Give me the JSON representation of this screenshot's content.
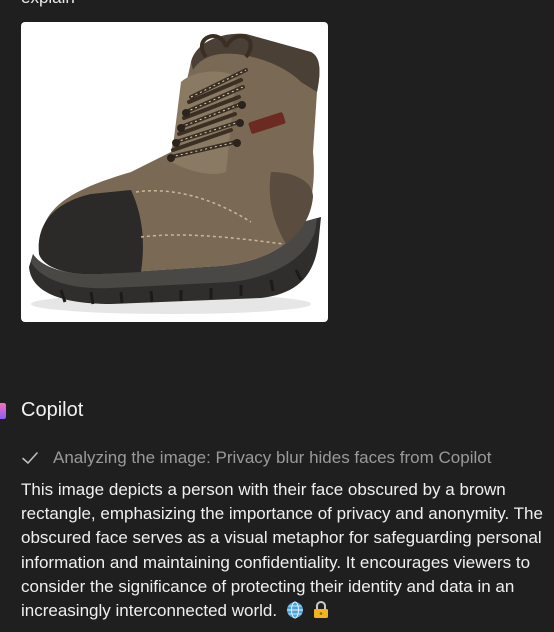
{
  "user_message": {
    "text": "explain"
  },
  "attachment": {
    "icon": "boot-image",
    "description_colors": {
      "boot_body": "#7a6a55",
      "toe_cap": "#2b2a28",
      "sole": "#3a3a38",
      "laces": "#3b2f24"
    }
  },
  "assistant": {
    "name": "Copilot",
    "status": "Analyzing the image: Privacy blur hides faces from Copilot",
    "response": "This image depicts a person with their face obscured by a brown rectangle, emphasizing the importance of privacy and anonymity. The obscured face serves as a visual metaphor for safeguarding personal information and maintaining confidentiality. It encourages viewers to consider the significance of protecting their identity and data in an increasingly interconnected world.",
    "emojis": [
      "globe-icon",
      "lock-icon"
    ]
  },
  "colors": {
    "background": "#1f1f1f",
    "status_text": "#9a9a9a",
    "primary_text": "#f0f0f0"
  }
}
